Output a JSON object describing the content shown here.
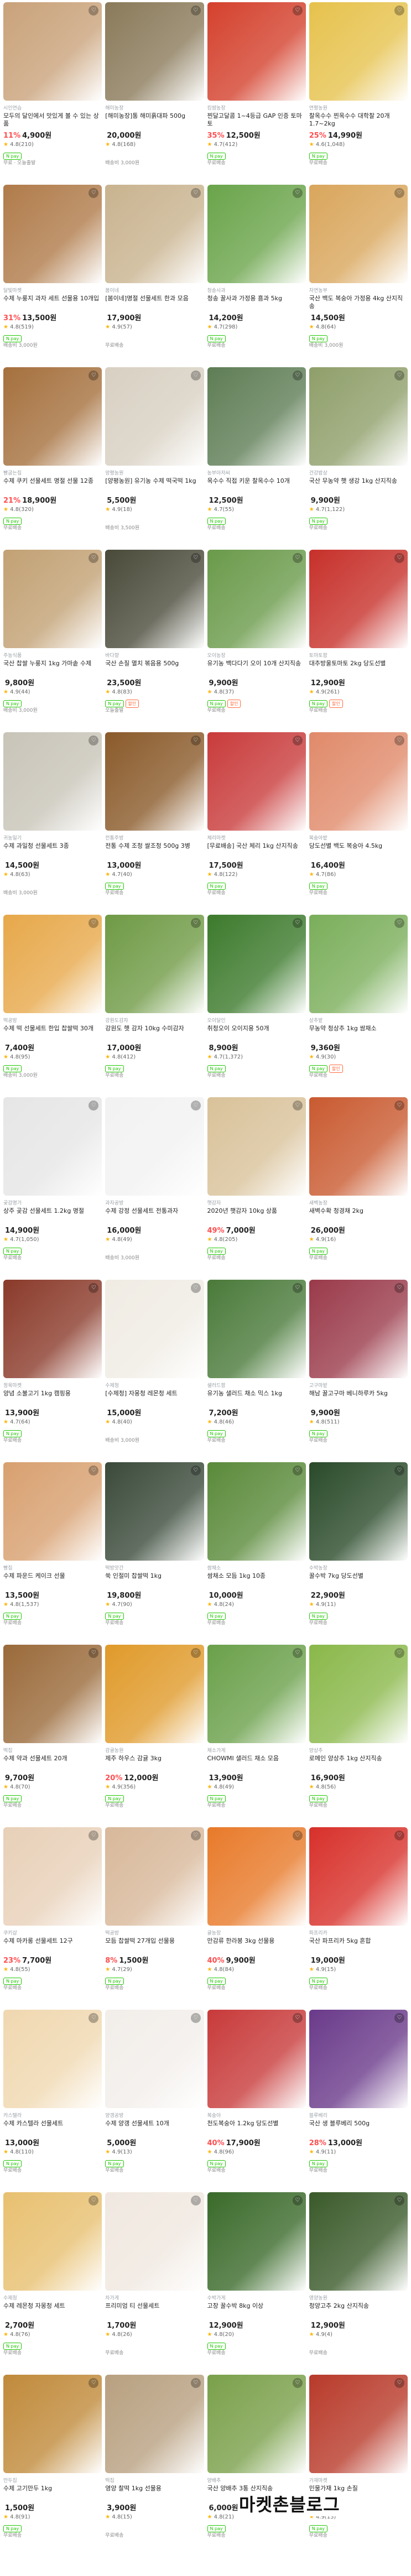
{
  "watermark": "마켓촌블로그",
  "items": [
    {
      "shop": "시인연습",
      "title": "모두의 달인에서 맛있게 볼 수 있는 상품",
      "disc": "11%",
      "price": "4,900원",
      "orig": "",
      "rating": "4.8(210)",
      "badges": [
        "N pay"
      ],
      "delivery": "무료 · 오늘출발",
      "color": "#c9a27a"
    },
    {
      "shop": "해미농장",
      "title": "[해미농장]통 해미흙대파 500g",
      "disc": "",
      "price": "20,000원",
      "orig": "",
      "rating": "4.8(168)",
      "badges": [],
      "delivery": "배송비 3,000원",
      "color": "#8a7a5a"
    },
    {
      "shop": "킹쌈농장",
      "title": "찐달고달콤 1~4등급 GAP 인증 토마토",
      "disc": "35%",
      "price": "12,500원",
      "orig": "",
      "rating": "4.7(412)",
      "badges": [
        "N pay"
      ],
      "delivery": "무료배송",
      "color": "#d4412d"
    },
    {
      "shop": "연평농원",
      "title": "찰옥수수 찐옥수수 대학찰 20개 1.7~2kg",
      "disc": "25%",
      "price": "14,990원",
      "orig": "",
      "rating": "4.6(1,048)",
      "badges": [
        "N pay"
      ],
      "delivery": "무료배송",
      "color": "#e6c24d"
    },
    {
      "shop": "달빛마켓",
      "title": "수제 누룽지 과자 세트 선물용 10개입",
      "disc": "31%",
      "price": "13,500원",
      "orig": "",
      "rating": "4.8(519)",
      "badges": [
        "N pay"
      ],
      "delivery": "배송비 3,000원",
      "color": "#b07b4a"
    },
    {
      "shop": "봄이네",
      "title": "[봄이네]명절 선물세트 한과 모음",
      "disc": "",
      "price": "17,900원",
      "orig": "",
      "rating": "4.9(57)",
      "badges": [],
      "delivery": "무료배송",
      "color": "#c9b38f"
    },
    {
      "shop": "청송사과",
      "title": "청송 꿀사과 가정용 흠과 5kg",
      "disc": "",
      "price": "14,200원",
      "orig": "",
      "rating": "4.7(298)",
      "badges": [
        "N pay"
      ],
      "delivery": "무료배송",
      "color": "#6aa44a"
    },
    {
      "shop": "자연농부",
      "title": "국산 백도 복숭아 가정용 4kg 산지직송",
      "disc": "",
      "price": "14,500원",
      "orig": "",
      "rating": "4.8(64)",
      "badges": [
        "N pay"
      ],
      "delivery": "배송비 3,000원",
      "color": "#d9a65c"
    },
    {
      "shop": "빵굽는집",
      "title": "수제 쿠키 선물세트 명절 선물 12종",
      "disc": "21%",
      "price": "18,900원",
      "orig": "",
      "rating": "4.8(320)",
      "badges": [
        "N pay"
      ],
      "delivery": "무료배송",
      "color": "#a5703d"
    },
    {
      "shop": "양평농원",
      "title": "[양평농원] 유기농 수제 떡국떡 1kg",
      "disc": "",
      "price": "5,500원",
      "orig": "",
      "rating": "4.9(18)",
      "badges": [],
      "delivery": "배송비 3,500원",
      "color": "#d8d0c2"
    },
    {
      "shop": "농부아저씨",
      "title": "옥수수 직접 키운 찰옥수수 10개",
      "disc": "",
      "price": "12,500원",
      "orig": "",
      "rating": "4.7(55)",
      "badges": [
        "N pay"
      ],
      "delivery": "무료배송",
      "color": "#5e7d55"
    },
    {
      "shop": "건강밥상",
      "title": "국산 무농약 햇 생강 1kg 산지직송",
      "disc": "",
      "price": "9,900원",
      "orig": "",
      "rating": "4.7(1,122)",
      "badges": [
        "N pay"
      ],
      "delivery": "무료배송",
      "color": "#8f9f6a"
    },
    {
      "shop": "주농식품",
      "title": "국산 찹쌀 누룽지 1kg 가마솥 수제",
      "disc": "",
      "price": "9,800원",
      "orig": "",
      "rating": "4.9(44)",
      "badges": [
        "N pay"
      ],
      "delivery": "배송비 3,000원",
      "color": "#c2a174"
    },
    {
      "shop": "바다향",
      "title": "국산 손질 멸치 볶음용 500g",
      "disc": "",
      "price": "23,500원",
      "orig": "",
      "rating": "4.8(83)",
      "badges": [
        "N pay",
        "할인"
      ],
      "delivery": "오늘출발",
      "color": "#4a4a3a"
    },
    {
      "shop": "오이농장",
      "title": "유기농 백다다기 오이 10개 산지직송",
      "disc": "",
      "price": "9,900원",
      "orig": "",
      "rating": "4.8(37)",
      "badges": [
        "N pay",
        "할인"
      ],
      "delivery": "무료배송",
      "color": "#6a9a4a"
    },
    {
      "shop": "토마토팜",
      "title": "대추방울토마토 2kg 당도선별",
      "disc": "",
      "price": "12,900원",
      "orig": "",
      "rating": "4.9(261)",
      "badges": [
        "N pay",
        "할인"
      ],
      "delivery": "무료배송",
      "color": "#c7302a"
    },
    {
      "shop": "귀농일기",
      "title": "수제 과일청 선물세트 3종",
      "disc": "",
      "price": "14,500원",
      "orig": "",
      "rating": "4.8(63)",
      "badges": [],
      "delivery": "배송비 3,000원",
      "color": "#c8c4b8"
    },
    {
      "shop": "전통주방",
      "title": "전통 수제 조청 쌀조청 500g 3병",
      "disc": "",
      "price": "13,000원",
      "orig": "",
      "rating": "4.7(40)",
      "badges": [
        "N pay"
      ],
      "delivery": "무료배송",
      "color": "#8a5a2a"
    },
    {
      "shop": "체리마켓",
      "title": "[무료배송] 국산 체리 1kg 산지직송",
      "disc": "",
      "price": "17,500원",
      "orig": "",
      "rating": "4.8(122)",
      "badges": [
        "N pay"
      ],
      "delivery": "무료배송",
      "color": "#c93b3b"
    },
    {
      "shop": "복숭아밭",
      "title": "당도선별 백도 복숭아 4.5kg",
      "disc": "",
      "price": "16,400원",
      "orig": "",
      "rating": "4.7(86)",
      "badges": [
        "N pay"
      ],
      "delivery": "무료배송",
      "color": "#e08a6a"
    },
    {
      "shop": "떡공방",
      "title": "수제 떡 선물세트 한입 찹쌀떡 30개",
      "disc": "",
      "price": "7,400원",
      "orig": "",
      "rating": "4.8(95)",
      "badges": [
        "N pay"
      ],
      "delivery": "배송비 3,000원",
      "color": "#e7a84a"
    },
    {
      "shop": "강원도감자",
      "title": "강원도 햇 감자 10kg 수미감자",
      "disc": "",
      "price": "17,000원",
      "orig": "",
      "rating": "4.8(412)",
      "badges": [
        "N pay"
      ],
      "delivery": "무료배송",
      "color": "#6f9a45"
    },
    {
      "shop": "오이달인",
      "title": "취청오이 오이지용 50개",
      "disc": "",
      "price": "8,900원",
      "orig": "",
      "rating": "4.7(1,372)",
      "badges": [
        "N pay"
      ],
      "delivery": "무료배송",
      "color": "#3c7a2c"
    },
    {
      "shop": "상추밭",
      "title": "무농약 청상추 1kg 쌈채소",
      "disc": "",
      "price": "9,360원",
      "orig": "",
      "rating": "4.9(30)",
      "badges": [
        "N pay",
        "할인"
      ],
      "delivery": "무료배송",
      "color": "#7aae5a"
    },
    {
      "shop": "곶감명가",
      "title": "상주 곶감 선물세트 1.2kg 명절",
      "disc": "",
      "price": "14,900원",
      "orig": "",
      "rating": "4.7(1,050)",
      "badges": [
        "N pay"
      ],
      "delivery": "무료배송",
      "color": "#e6e6e6"
    },
    {
      "shop": "과자공방",
      "title": "수제 강정 선물세트 전통과자",
      "disc": "",
      "price": "16,000원",
      "orig": "",
      "rating": "4.8(49)",
      "badges": [],
      "delivery": "배송비 3,000원",
      "color": "#f2f2f2"
    },
    {
      "shop": "햇감자",
      "title": "2020년 햇감자 10kg 상품",
      "disc": "49%",
      "price": "7,000원",
      "orig": "",
      "rating": "4.8(205)",
      "badges": [
        "N pay"
      ],
      "delivery": "무료배송",
      "color": "#d9c29a"
    },
    {
      "shop": "새벽농장",
      "title": "새벽수확 청경채 2kg",
      "disc": "",
      "price": "26,000원",
      "orig": "",
      "rating": "4.9(16)",
      "badges": [
        "N pay"
      ],
      "delivery": "무료배송",
      "color": "#c95a30"
    },
    {
      "shop": "정육마켓",
      "title": "양념 소불고기 1kg 캠핑용",
      "disc": "",
      "price": "13,900원",
      "orig": "",
      "rating": "4.7(64)",
      "badges": [
        "N pay"
      ],
      "delivery": "무료배송",
      "color": "#8a3a2a"
    },
    {
      "shop": "수제청",
      "title": "[수제청] 자몽청 레몬청 세트",
      "disc": "",
      "price": "15,000원",
      "orig": "",
      "rating": "4.8(40)",
      "badges": [],
      "delivery": "배송비 3,000원",
      "color": "#f0ece4"
    },
    {
      "shop": "샐러드팜",
      "title": "유기농 샐러드 채소 믹스 1kg",
      "disc": "",
      "price": "7,200원",
      "orig": "",
      "rating": "4.8(46)",
      "badges": [
        "N pay"
      ],
      "delivery": "무료배송",
      "color": "#4a7a3a"
    },
    {
      "shop": "고구마밭",
      "title": "해남 꿀고구마 베니하루카 5kg",
      "disc": "",
      "price": "9,900원",
      "orig": "",
      "rating": "4.8(511)",
      "badges": [
        "N pay"
      ],
      "delivery": "무료배송",
      "color": "#9a3a4a"
    },
    {
      "shop": "빵집",
      "title": "수제 파운드 케이크 선물",
      "disc": "",
      "price": "13,500원",
      "orig": "",
      "rating": "4.8(1,537)",
      "badges": [
        "N pay"
      ],
      "delivery": "무료배송",
      "color": "#d8a070"
    },
    {
      "shop": "떡방앗간",
      "title": "쑥 인절미 찹쌀떡 1kg",
      "disc": "",
      "price": "19,800원",
      "orig": "",
      "rating": "4.7(90)",
      "badges": [
        "N pay"
      ],
      "delivery": "무료배송",
      "color": "#3a4a3a"
    },
    {
      "shop": "쌈채소",
      "title": "쌈채소 모듬 1kg 10종",
      "disc": "",
      "price": "10,000원",
      "orig": "",
      "rating": "4.8(24)",
      "badges": [
        "N pay"
      ],
      "delivery": "무료배송",
      "color": "#5a8a3a"
    },
    {
      "shop": "수박농장",
      "title": "꿀수박 7kg 당도선별",
      "disc": "",
      "price": "22,900원",
      "orig": "",
      "rating": "4.9(11)",
      "badges": [
        "N pay"
      ],
      "delivery": "무료배송",
      "color": "#2a4a2a"
    },
    {
      "shop": "떡집",
      "title": "수제 약과 선물세트 20개",
      "disc": "",
      "price": "9,700원",
      "orig": "",
      "rating": "4.8(70)",
      "badges": [
        "N pay"
      ],
      "delivery": "무료배송",
      "color": "#9a6a3a"
    },
    {
      "shop": "감귤농원",
      "title": "제주 하우스 감귤 3kg",
      "disc": "20%",
      "price": "12,000원",
      "orig": "",
      "rating": "4.9(356)",
      "badges": [
        "N pay"
      ],
      "delivery": "무료배송",
      "color": "#e09a2a"
    },
    {
      "shop": "채소가게",
      "title": "CHOWMI 샐러드 채소 모음",
      "disc": "",
      "price": "13,900원",
      "orig": "",
      "rating": "4.8(49)",
      "badges": [
        "N pay"
      ],
      "delivery": "무료배송",
      "color": "#6aa04a"
    },
    {
      "shop": "양상추",
      "title": "로메인 양상추 1kg 산지직송",
      "disc": "",
      "price": "16,900원",
      "orig": "",
      "rating": "4.8(56)",
      "badges": [
        "N pay"
      ],
      "delivery": "무료배송",
      "color": "#8ab84a"
    },
    {
      "shop": "쿠키샵",
      "title": "수제 마카롱 선물세트 12구",
      "disc": "23%",
      "price": "7,700원",
      "orig": "",
      "rating": "4.8(55)",
      "badges": [
        "N pay"
      ],
      "delivery": "무료배송",
      "color": "#e8d0b8"
    },
    {
      "shop": "떡공방",
      "title": "모듬 찹쌀떡 27개입 선물용",
      "disc": "8%",
      "price": "1,500원",
      "orig": "",
      "rating": "4.7(29)",
      "badges": [
        "N pay"
      ],
      "delivery": "무료배송",
      "color": "#d8b89a"
    },
    {
      "shop": "귤농장",
      "title": "만감류 한라봉 3kg 선물용",
      "disc": "40%",
      "price": "9,900원",
      "orig": "",
      "rating": "4.8(84)",
      "badges": [
        "N pay"
      ],
      "delivery": "무료배송",
      "color": "#e87a2a"
    },
    {
      "shop": "파프리카",
      "title": "국산 파프리카 5kg 혼합",
      "disc": "",
      "price": "19,000원",
      "orig": "",
      "rating": "4.9(15)",
      "badges": [
        "N pay"
      ],
      "delivery": "무료배송",
      "color": "#d8302a"
    },
    {
      "shop": "카스텔라",
      "title": "수제 카스텔라 선물세트",
      "disc": "",
      "price": "13,000원",
      "orig": "",
      "rating": "4.8(110)",
      "badges": [
        "N pay"
      ],
      "delivery": "무료배송",
      "color": "#f0d8b0"
    },
    {
      "shop": "양갱공방",
      "title": "수제 양갱 선물세트 10개",
      "disc": "",
      "price": "5,000원",
      "orig": "",
      "rating": "4.9(13)",
      "badges": [
        "N pay"
      ],
      "delivery": "무료배송",
      "color": "#f2eeea"
    },
    {
      "shop": "복숭아",
      "title": "천도복숭아 1.2kg 당도선별",
      "disc": "40%",
      "price": "17,900원",
      "orig": "",
      "rating": "4.8(96)",
      "badges": [
        "N pay"
      ],
      "delivery": "무료배송",
      "color": "#c83a3a"
    },
    {
      "shop": "블루베리",
      "title": "국산 생 블루베리 500g",
      "disc": "28%",
      "price": "13,000원",
      "orig": "",
      "rating": "4.9(11)",
      "badges": [
        "N pay"
      ],
      "delivery": "무료배송",
      "color": "#6a3a8a"
    },
    {
      "shop": "수제청",
      "title": "수제 레몬청 자몽청 세트",
      "disc": "",
      "price": "2,700원",
      "orig": "",
      "rating": "4.8(76)",
      "badges": [
        "N pay"
      ],
      "delivery": "무료배송",
      "color": "#e8c070"
    },
    {
      "shop": "차가게",
      "title": "프리미엄 티 선물세트",
      "disc": "",
      "price": "1,700원",
      "orig": "",
      "rating": "4.8(26)",
      "badges": [],
      "delivery": "무료배송",
      "color": "#f0e8e0"
    },
    {
      "shop": "수박가게",
      "title": "고창 꿀수박 8kg 이상",
      "disc": "",
      "price": "12,900원",
      "orig": "",
      "rating": "4.8(20)",
      "badges": [
        "N pay"
      ],
      "delivery": "무료배송",
      "color": "#3a6a2a"
    },
    {
      "shop": "영양농원",
      "title": "청양고추 2kg 산지직송",
      "disc": "",
      "price": "12,900원",
      "orig": "",
      "rating": "4.9(4)",
      "badges": [],
      "delivery": "무료배송",
      "color": "#3a5a2a"
    },
    {
      "shop": "만두집",
      "title": "수제 고기만두 1kg",
      "disc": "",
      "price": "1,500원",
      "orig": "",
      "rating": "4.8(91)",
      "badges": [
        "N pay"
      ],
      "delivery": "무료배송",
      "color": "#c08a3a"
    },
    {
      "shop": "떡집",
      "title": "영양 찰떡 1kg 선물용",
      "disc": "",
      "price": "3,900원",
      "orig": "",
      "rating": "4.8(15)",
      "badges": [],
      "delivery": "무료배송",
      "color": "#b8a080"
    },
    {
      "shop": "양배추",
      "title": "국산 양배추 3통 산지직송",
      "disc": "",
      "price": "6,000원",
      "orig": "",
      "rating": "4.8(21)",
      "badges": [
        "N pay"
      ],
      "delivery": "무료배송",
      "color": "#7aa04a"
    },
    {
      "shop": "가재마켓",
      "title": "민물가재 1kg 손질",
      "disc": "",
      "price": "11,900원",
      "orig": "",
      "rating": "4.9(13)",
      "badges": [
        "N pay"
      ],
      "delivery": "무료배송",
      "color": "#b83a2a"
    }
  ]
}
